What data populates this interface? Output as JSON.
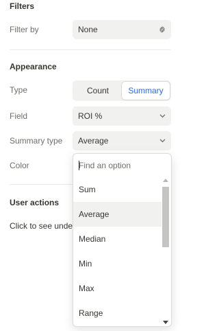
{
  "filters": {
    "title": "Filters",
    "filter_by_label": "Filter by",
    "filter_by_value": "None"
  },
  "appearance": {
    "title": "Appearance",
    "type_label": "Type",
    "type_options": [
      "Count",
      "Summary"
    ],
    "type_selected": "Summary",
    "field_label": "Field",
    "field_value": "ROI %",
    "summary_type_label": "Summary type",
    "summary_type_value": "Average",
    "color_label": "Color"
  },
  "user_actions": {
    "title": "User actions",
    "click_text": "Click to see under"
  },
  "dropdown": {
    "search_placeholder": "Find an option",
    "options": [
      "Sum",
      "Average",
      "Median",
      "Min",
      "Max",
      "Range"
    ],
    "hovered": "Average"
  },
  "colors": {
    "accent": "#2e6bd5",
    "field_bg": "#f1f1ef",
    "text": "#37352f",
    "muted": "#6f6e69"
  }
}
